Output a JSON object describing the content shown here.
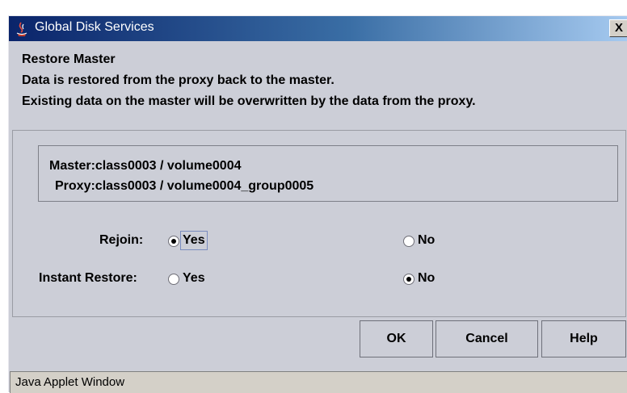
{
  "window": {
    "title": "Global Disk Services",
    "close_label": "X",
    "title_icon": "java-coffee-icon"
  },
  "dialog": {
    "heading": "Restore Master",
    "line1": "Data is restored from the proxy back to the master.",
    "line2": "Existing data on the master will be overwritten by the data from the proxy."
  },
  "info": {
    "master": "Master:class0003 / volume0004",
    "proxy": "Proxy:class0003 / volume0004_group0005"
  },
  "options": {
    "rejoin": {
      "label": "Rejoin:",
      "yes_label": "Yes",
      "no_label": "No",
      "selected": "Yes"
    },
    "instant_restore": {
      "label": "Instant Restore:",
      "yes_label": "Yes",
      "no_label": "No",
      "selected": "No"
    }
  },
  "buttons": {
    "ok": "OK",
    "cancel": "Cancel",
    "help": "Help"
  },
  "status": {
    "text": "Java Applet Window"
  }
}
